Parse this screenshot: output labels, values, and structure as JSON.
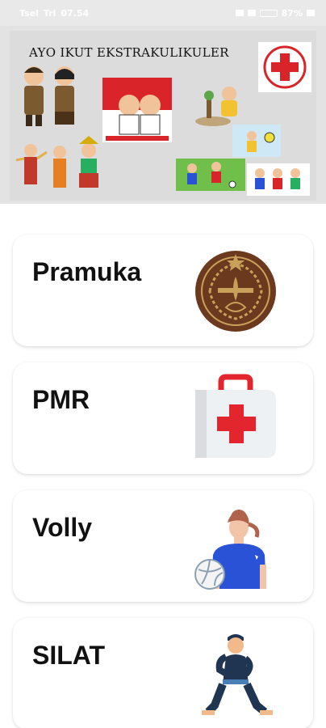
{
  "status_bar": {
    "carrier": "Tsel",
    "carrier2": "Tri",
    "time": "07.54",
    "battery": "87%"
  },
  "banner": {
    "title": "AYO IKUT EKSTRAKULIKULER",
    "icons": [
      "scout-kids-image",
      "red-cross-logo",
      "flag-ceremony-image",
      "gardening-kid-image",
      "cultural-dancers-image",
      "soccer-image",
      "sports-kids-image"
    ]
  },
  "activities": [
    {
      "label": "Pramuka",
      "icon": "scout-emblem-icon"
    },
    {
      "label": "PMR",
      "icon": "first-aid-kit-icon"
    },
    {
      "label": "Volly",
      "icon": "volleyball-player-icon"
    },
    {
      "label": "SILAT",
      "icon": "silat-fighter-icon"
    }
  ],
  "colors": {
    "scout_brown": "#6b3a1e",
    "scout_gold": "#c9a05a",
    "red": "#e3262d",
    "kit_white": "#eef1f3",
    "volly_blue": "#2a52d6",
    "silat_navy": "#1f3552"
  }
}
